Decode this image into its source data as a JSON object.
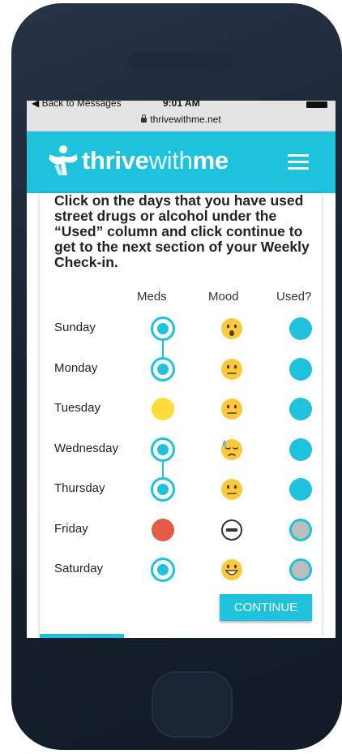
{
  "status_bar": {
    "back_label": "◀ Back to Messages",
    "time": "9:01 AM"
  },
  "browser": {
    "url": "thrivewithme.net"
  },
  "header": {
    "logo_bold": "thrive",
    "logo_light": "with",
    "logo_bold2": "me",
    "menu_icon": "hamburger-menu-icon"
  },
  "instructions": "Click on the days that you have used street drugs or alcohol under the “Used” column and click continue to get to the next section of your Weekly Check-in.",
  "columns": {
    "meds": "Meds",
    "mood": "Mood",
    "used": "Used?"
  },
  "colors": {
    "accent": "#1fc2dd",
    "missed": "#e35c48",
    "partial": "#fddb3a",
    "unchecked": "#bdbdbd"
  },
  "days": [
    {
      "day": "Sunday",
      "meds": "taken",
      "mood": "surprised",
      "used": "filled"
    },
    {
      "day": "Monday",
      "meds": "taken",
      "mood": "neutral",
      "used": "filled"
    },
    {
      "day": "Tuesday",
      "meds": "partial",
      "mood": "neutral",
      "used": "filled"
    },
    {
      "day": "Wednesday",
      "meds": "taken",
      "mood": "sad-sweat",
      "used": "filled"
    },
    {
      "day": "Thursday",
      "meds": "taken",
      "mood": "neutral",
      "used": "filled"
    },
    {
      "day": "Friday",
      "meds": "missed",
      "mood": "no-entry",
      "used": "ring"
    },
    {
      "day": "Saturday",
      "meds": "taken",
      "mood": "grinning",
      "used": "ring"
    }
  ],
  "continue_label": "CONTINUE"
}
